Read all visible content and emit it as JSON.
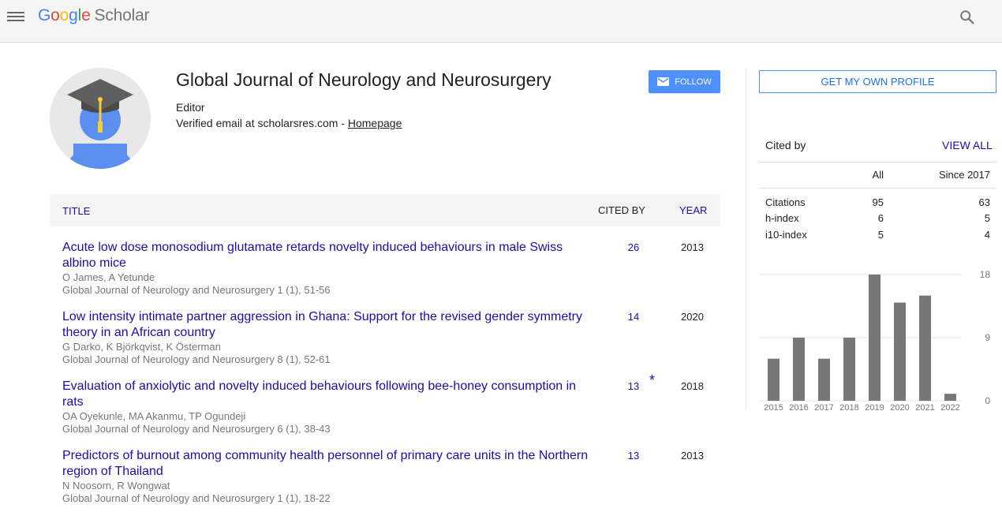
{
  "header": {
    "logo_letters": [
      {
        "char": "G",
        "color": "#4285f4"
      },
      {
        "char": "o",
        "color": "#ea4335"
      },
      {
        "char": "o",
        "color": "#fbbc05"
      },
      {
        "char": "g",
        "color": "#4285f4"
      },
      {
        "char": "l",
        "color": "#34a853"
      },
      {
        "char": "e",
        "color": "#ea4335"
      }
    ],
    "logo_product": "Scholar",
    "menu_icon": "hamburger-menu-icon",
    "search_icon": "magnifier-icon"
  },
  "profile": {
    "name": "Global Journal of Neurology and Neurosurgery",
    "affiliation": "Editor",
    "email_text": "Verified email at scholarsres.com - ",
    "homepage_label": "Homepage",
    "follow_label": "FOLLOW",
    "avatar_icon": "graduate-avatar-icon"
  },
  "table": {
    "col_title": "TITLE",
    "col_cited": "CITED BY",
    "col_year": "YEAR",
    "rows": [
      {
        "title": "Acute low dose monosodium glutamate retards novelty induced behaviours in male Swiss albino mice",
        "authors": "O James, A Yetunde",
        "venue": "Global Journal of Neurology and Neurosurgery 1 (1), 51-56",
        "cites": "26",
        "star": "",
        "year": "2013"
      },
      {
        "title": "Low intensity intimate partner aggression in Ghana: Support for the revised gender symmetry theory in an African country",
        "authors": "G Darko, K Björkqvist, K Österman",
        "venue": "Global Journal of Neurology and Neurosurgery 8 (1), 52-61",
        "cites": "14",
        "star": "",
        "year": "2020"
      },
      {
        "title": "Evaluation of anxiolytic and novelty induced behaviours following bee-honey consumption in rats",
        "authors": "OA Oyekunle, MA Akanmu, TP Ogundeji",
        "venue": "Global Journal of Neurology and Neurosurgery 6 (1), 38-43",
        "cites": "13",
        "star": "*",
        "year": "2018"
      },
      {
        "title": "Predictors of burnout among community health personnel of primary care units in the Northern region of Thailand",
        "authors": "N Noosorn, R Wongwat",
        "venue": "Global Journal of Neurology and Neurosurgery 1 (1), 18-22",
        "cites": "13",
        "star": "",
        "year": "2013"
      }
    ]
  },
  "sidebar": {
    "get_profile_label": "GET MY OWN PROFILE",
    "cited_by_label": "Cited by",
    "view_all_label": "VIEW ALL",
    "col_all": "All",
    "col_since": "Since 2017",
    "stats": [
      {
        "label": "Citations",
        "all": "95",
        "since": "63"
      },
      {
        "label": "h-index",
        "all": "6",
        "since": "5"
      },
      {
        "label": "i10-index",
        "all": "5",
        "since": "4"
      }
    ]
  },
  "chart_data": {
    "type": "bar",
    "categories": [
      "2015",
      "2016",
      "2017",
      "2018",
      "2019",
      "2020",
      "2021",
      "2022"
    ],
    "values": [
      6,
      9,
      6,
      9,
      18,
      14,
      15,
      1
    ],
    "yticks": [
      0,
      9,
      18
    ],
    "ylim": [
      0,
      18
    ],
    "bar_color": "#777777",
    "grid": true
  }
}
